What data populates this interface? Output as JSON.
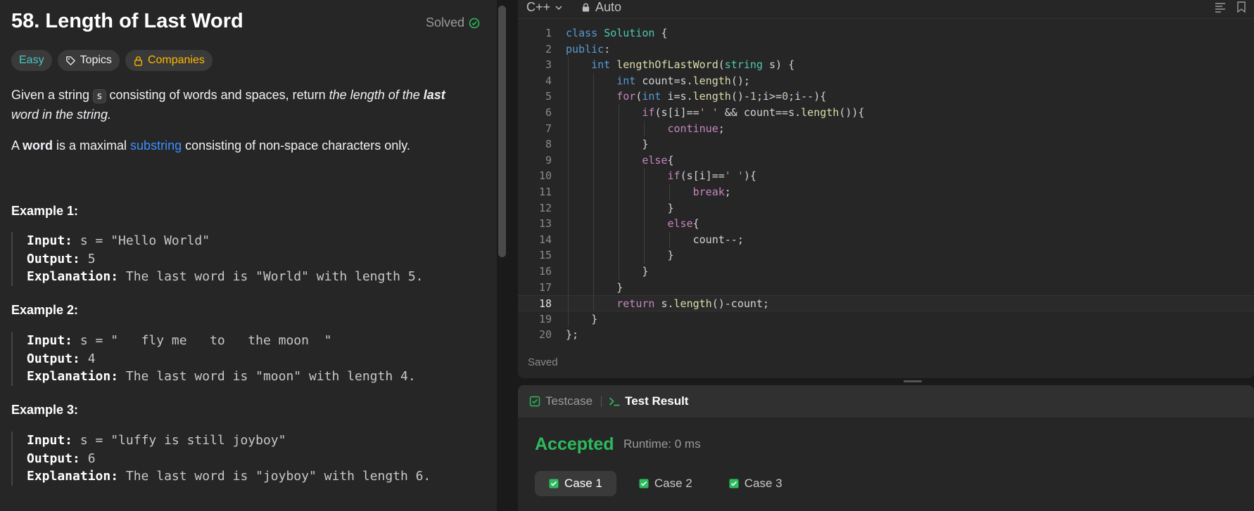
{
  "problem": {
    "title": "58. Length of Last Word",
    "status": "Solved",
    "tags": [
      "Easy",
      "Topics",
      "Companies"
    ],
    "desc1_a": "Given a string ",
    "desc1_code": "s",
    "desc1_b": " consisting of words and spaces, return ",
    "desc1_c": "the length of the ",
    "desc1_d": "last",
    "desc1_e": " word in the string.",
    "desc2_a": "A ",
    "desc2_b": "word",
    "desc2_c": " is a maximal ",
    "desc2_link": "substring",
    "desc2_d": " consisting of non-space characters only.",
    "examples": [
      {
        "title": "Example 1:",
        "input_label": "Input:",
        "input": " s = \"Hello World\"",
        "output_label": "Output:",
        "output": " 5",
        "expl_label": "Explanation:",
        "explanation": " The last word is \"World\" with length 5."
      },
      {
        "title": "Example 2:",
        "input_label": "Input:",
        "input": " s = \"   fly me   to   the moon  \"",
        "output_label": "Output:",
        "output": " 4",
        "expl_label": "Explanation:",
        "explanation": " The last word is \"moon\" with length 4."
      },
      {
        "title": "Example 3:",
        "input_label": "Input:",
        "input": " s = \"luffy is still joyboy\"",
        "output_label": "Output:",
        "output": " 6",
        "expl_label": "Explanation:",
        "explanation": " The last word is \"joyboy\" with length 6."
      }
    ]
  },
  "editor": {
    "language": "C++",
    "mode": "Auto",
    "saved": "Saved",
    "active_line": 18,
    "line_numbers": [
      "1",
      "2",
      "3",
      "4",
      "5",
      "6",
      "7",
      "8",
      "9",
      "10",
      "11",
      "12",
      "13",
      "14",
      "15",
      "16",
      "17",
      "18",
      "19",
      "20"
    ]
  },
  "result": {
    "tab_testcase": "Testcase",
    "tab_result": "Test Result",
    "status": "Accepted",
    "runtime": "Runtime: 0 ms",
    "cases": [
      "Case 1",
      "Case 2",
      "Case 3"
    ]
  },
  "colors": {
    "accent_green": "#2cbb5d",
    "easy": "#46c6c2",
    "companies": "#ffb800",
    "link": "#3b8fff"
  }
}
